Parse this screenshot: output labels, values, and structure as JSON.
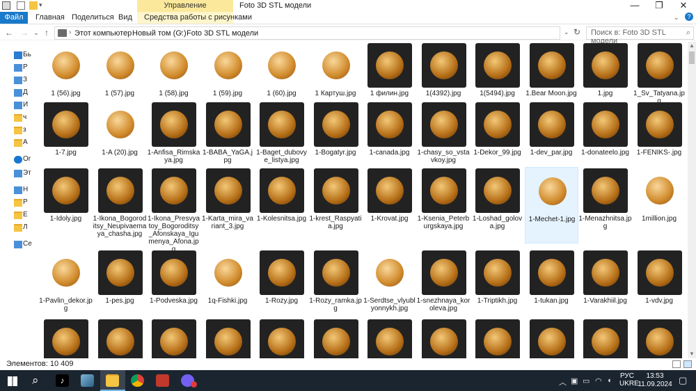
{
  "window": {
    "title": "Foto 3D  STL модели",
    "context_tab": "Управление",
    "controls": {
      "minimize": "—",
      "maximize": "❐",
      "close": "✕"
    }
  },
  "ribbon": {
    "tabs": [
      "Файл",
      "Главная",
      "Поделиться",
      "Вид",
      "Средства работы с рисунками"
    ]
  },
  "address": {
    "crumbs": [
      "Этот компьютер",
      "Новый том (G:)",
      "Foto 3D  STL модели"
    ],
    "search_placeholder": "Поиск в: Foto 3D  STL модели"
  },
  "navpane": {
    "items": [
      {
        "label": "Бь",
        "icon": "star-icon"
      },
      {
        "label": "Р",
        "icon": "desktop-icon"
      },
      {
        "label": "З",
        "icon": "download-icon"
      },
      {
        "label": "Д",
        "icon": "document-icon"
      },
      {
        "label": "И",
        "icon": "pictures-icon"
      },
      {
        "label": "ч",
        "icon": "folder-icon"
      },
      {
        "label": "з",
        "icon": "folder-icon"
      },
      {
        "label": "А",
        "icon": "folder-icon"
      },
      {
        "label": "Or",
        "icon": "cloud-icon"
      },
      {
        "label": "Эт",
        "icon": "computer-icon"
      },
      {
        "label": "Н",
        "icon": "drive-icon"
      },
      {
        "label": "Р",
        "icon": "folder-icon"
      },
      {
        "label": "Е",
        "icon": "folder-icon"
      },
      {
        "label": "Л",
        "icon": "folder-icon"
      },
      {
        "label": "Се",
        "icon": "network-icon"
      }
    ]
  },
  "files": [
    [
      "1 (56).jpg",
      "1 (57).jpg",
      "1 (58).jpg",
      "1 (59).jpg",
      "1 (60).jpg",
      "1 Картуш.jpg",
      "1 филин.jpg",
      "1(4392).jpg",
      "1(5494).jpg",
      "1.Bear Moon.jpg",
      "1.jpg",
      "1_Sv_Tatyana.jpg"
    ],
    [
      "1-7.jpg",
      "1-A (20).jpg",
      "1-Anfisa_Rimskaya.jpg",
      "1-BABA_YaGA.jpg",
      "1-Baget_dubovye_listya.jpg",
      "1-Bogatyr.jpg",
      "1-canada.jpg",
      "1-chasy_so_vstavkoy.jpg",
      "1-Dekor_99.jpg",
      "1-dev_par.jpg",
      "1-donateelo.jpg",
      "1-FENIKS-.jpg"
    ],
    [
      "1-Idoly.jpg",
      "1-Ikona_Bogoroditsy_Neupivaemaya_chasha.jpg",
      "1-Ikona_Presvyatoy_Bogoroditsy_Afonskaya_Igumenya_Afona.jpg",
      "1-Karta_mira_variant_3.jpg",
      "1-Kolesnitsa.jpg",
      "1-krest_Raspyatia.jpg",
      "1-Krovat.jpg",
      "1-Ksenia_Peterburgskaya.jpg",
      "1-Loshad_golova.jpg",
      "1-Mechet-1.jpg",
      "1-Menazhnitsa.jpg",
      "1million.jpg"
    ],
    [
      "1-Pavlin_dekor.jpg",
      "1-pes.jpg",
      "1-Podveska.jpg",
      "1q-Fishki.jpg",
      "1-Rozy.jpg",
      "1-Rozy_ramka.jpg",
      "1-Serdtse_vlyublyonnykh.jpg",
      "1-snezhnaya_koroleva.jpg",
      "1-Triptikh.jpg",
      "1-tukan.jpg",
      "1-Varakhiil.jpg",
      "1-vdv.jpg"
    ],
    [
      "",
      "",
      "",
      "",
      "",
      "",
      "",
      "",
      "",
      "",
      "",
      ""
    ]
  ],
  "selected_file": "1-Mechet-1.jpg",
  "status": {
    "count": "Элементов: 10 409"
  },
  "taskbar": {
    "apps": [
      "start-icon",
      "search-icon",
      "tiktok-icon",
      "app-icon",
      "file-explorer-icon",
      "chrome-icon",
      "app-icon",
      "viber-icon"
    ],
    "lang": [
      "РУС",
      "UKRE"
    ],
    "time": "13:53",
    "date": "11.09.2024"
  },
  "colors": {
    "accent": "#1979ca",
    "context_tab": "#fbe89a",
    "taskbar": "#1b2530"
  }
}
